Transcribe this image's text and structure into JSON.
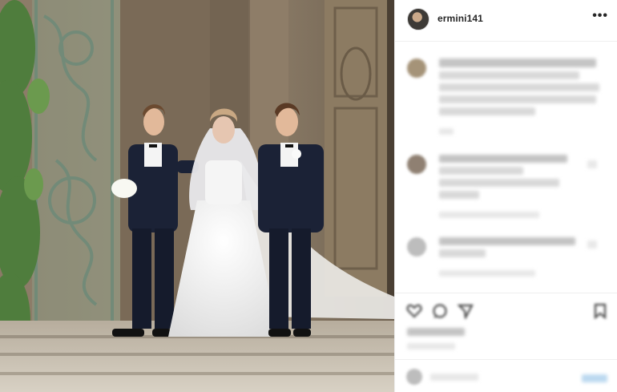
{
  "post": {
    "username": "ermini141",
    "more_icon": "more-horizontal-icon",
    "more_label": "•••"
  },
  "comments_state": "pixelated",
  "actions": {
    "icons": [
      "heart-icon",
      "comment-icon",
      "share-icon",
      "bookmark-icon"
    ]
  },
  "colors": {
    "panel_bg": "#ffffff",
    "divider": "#efefef",
    "text": "#262626",
    "link": "#0095f6"
  }
}
